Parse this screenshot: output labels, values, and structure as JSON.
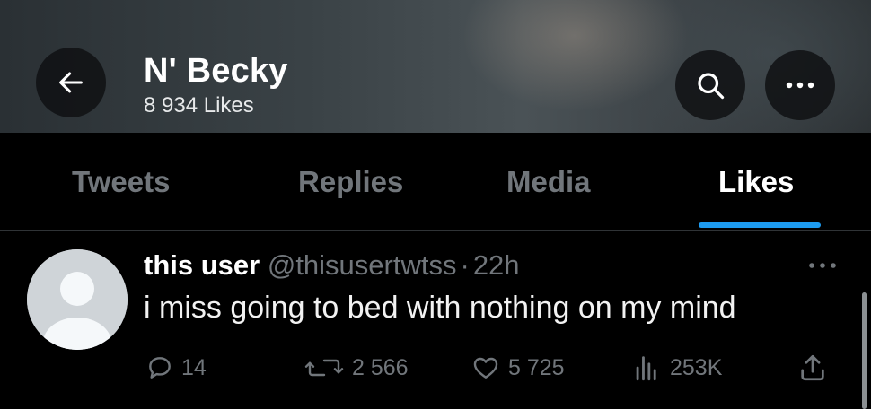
{
  "header": {
    "title": "N' Becky",
    "subtitle": "8 934 Likes"
  },
  "tabs": [
    {
      "label": "Tweets",
      "active": false
    },
    {
      "label": "Replies",
      "active": false
    },
    {
      "label": "Media",
      "active": false
    },
    {
      "label": "Likes",
      "active": true
    }
  ],
  "tweet": {
    "display_name": "this user",
    "handle": "@thisusertwtss",
    "separator": "·",
    "time": "22h",
    "text": "i miss going to bed with nothing on my mind",
    "actions": {
      "replies": "14",
      "retweets": "2 566",
      "likes": "5 725",
      "views": "253K"
    }
  },
  "colors": {
    "accent": "#1d9bf0",
    "muted": "#71767b",
    "background": "#000000"
  },
  "icons": [
    "back-arrow-icon",
    "search-icon",
    "more-icon",
    "reply-icon",
    "retweet-icon",
    "like-icon",
    "views-icon",
    "share-icon"
  ]
}
